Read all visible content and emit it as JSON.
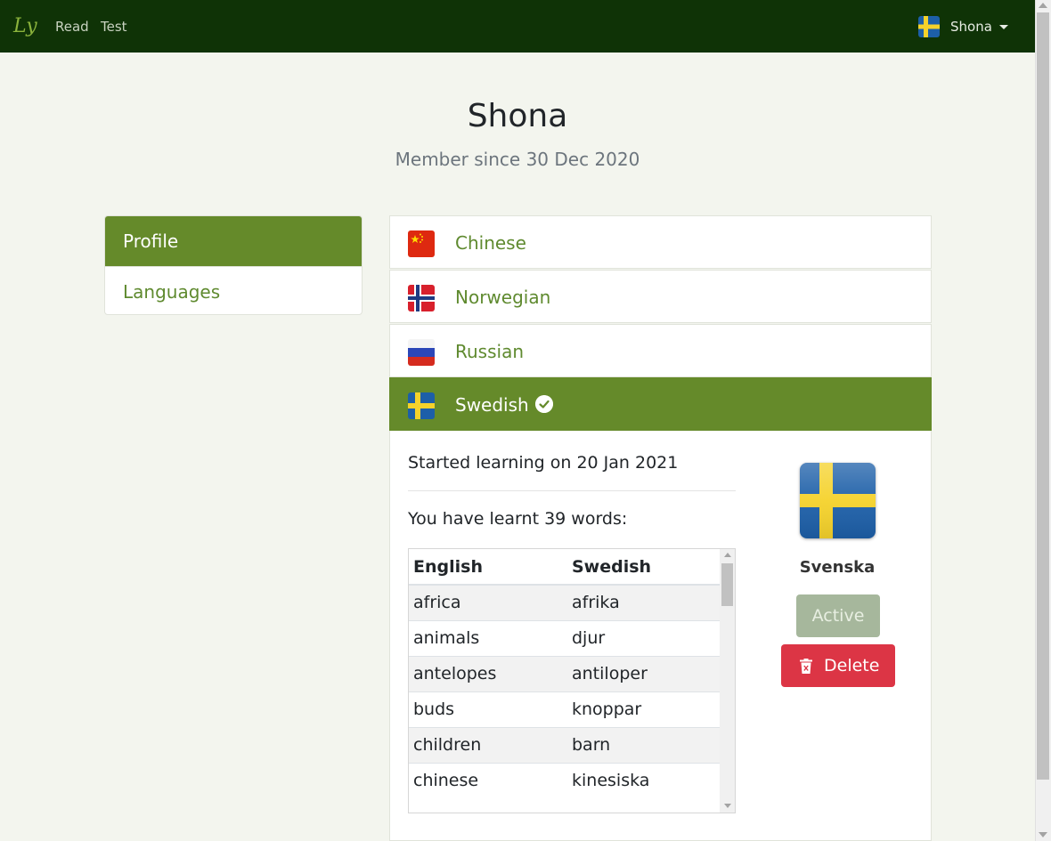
{
  "nav": {
    "brand": "Ly",
    "links": [
      "Read",
      "Test"
    ],
    "user": {
      "name": "Shona",
      "flag": "sweden-flag-icon"
    }
  },
  "header": {
    "title": "Shona",
    "subtitle": "Member since 30 Dec 2020"
  },
  "menu": {
    "items": [
      {
        "label": "Profile",
        "active": true
      },
      {
        "label": "Languages",
        "active": false
      }
    ]
  },
  "languages": [
    {
      "name": "Chinese",
      "flag": "china-flag-icon",
      "active": false
    },
    {
      "name": "Norwegian",
      "flag": "norway-flag-icon",
      "active": false
    },
    {
      "name": "Russian",
      "flag": "russia-flag-icon",
      "active": false
    },
    {
      "name": "Swedish",
      "flag": "sweden-flag-icon",
      "active": true
    }
  ],
  "detail": {
    "started": "Started learning on 20 Jan 2021",
    "learnt": "You have learnt 39 words:",
    "table": {
      "headers": [
        "English",
        "Swedish"
      ],
      "rows": [
        [
          "africa",
          "afrika"
        ],
        [
          "animals",
          "djur"
        ],
        [
          "antelopes",
          "antiloper"
        ],
        [
          "buds",
          "knoppar"
        ],
        [
          "children",
          "barn"
        ],
        [
          "chinese",
          "kinesiska"
        ]
      ]
    },
    "native_name": "Svenska",
    "active_button": "Active",
    "delete_button": "Delete"
  },
  "colors": {
    "navbar": "#0f3306",
    "accent": "#658a2a",
    "link": "#5f8a2f",
    "danger": "#dc3545"
  }
}
